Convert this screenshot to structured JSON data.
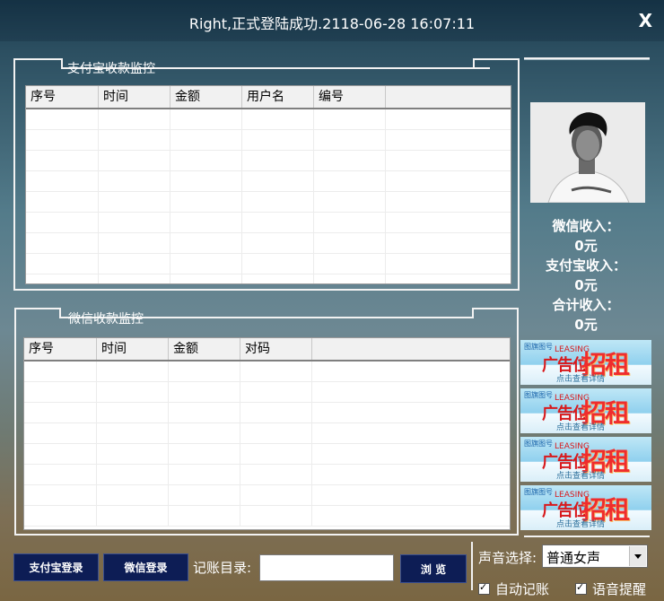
{
  "window": {
    "title": "Right,正式登陆成功.2118-06-28 16:07:11",
    "close_label": "X"
  },
  "alipay_monitor": {
    "title": "支付宝收款监控",
    "columns": [
      "序号",
      "时间",
      "金额",
      "用户名",
      "编号"
    ],
    "rows": []
  },
  "wechat_monitor": {
    "title": "微信收款监控",
    "columns": [
      "序号",
      "时间",
      "金额",
      "对码"
    ],
    "rows": []
  },
  "income": {
    "wechat_label": "微信收入：",
    "wechat_value": "0元",
    "alipay_label": "支付宝收入：",
    "alipay_value": "0元",
    "total_label": "合计收入：",
    "total_value": "0元"
  },
  "ad": {
    "top_line": "图旗图号",
    "leasing": "LEASING",
    "main_small": "广告位",
    "main_big": "招租",
    "tag": "点击查看详情"
  },
  "bottom": {
    "alipay_login": "支付宝登录",
    "wechat_login": "微信登录",
    "ledger_dir_label": "记账目录:",
    "ledger_dir_value": "",
    "browse": "浏 览",
    "sound_label": "声音选择:",
    "sound_value": "普通女声",
    "auto_ledger": "自动记账",
    "voice_alert": "语音提醒"
  }
}
